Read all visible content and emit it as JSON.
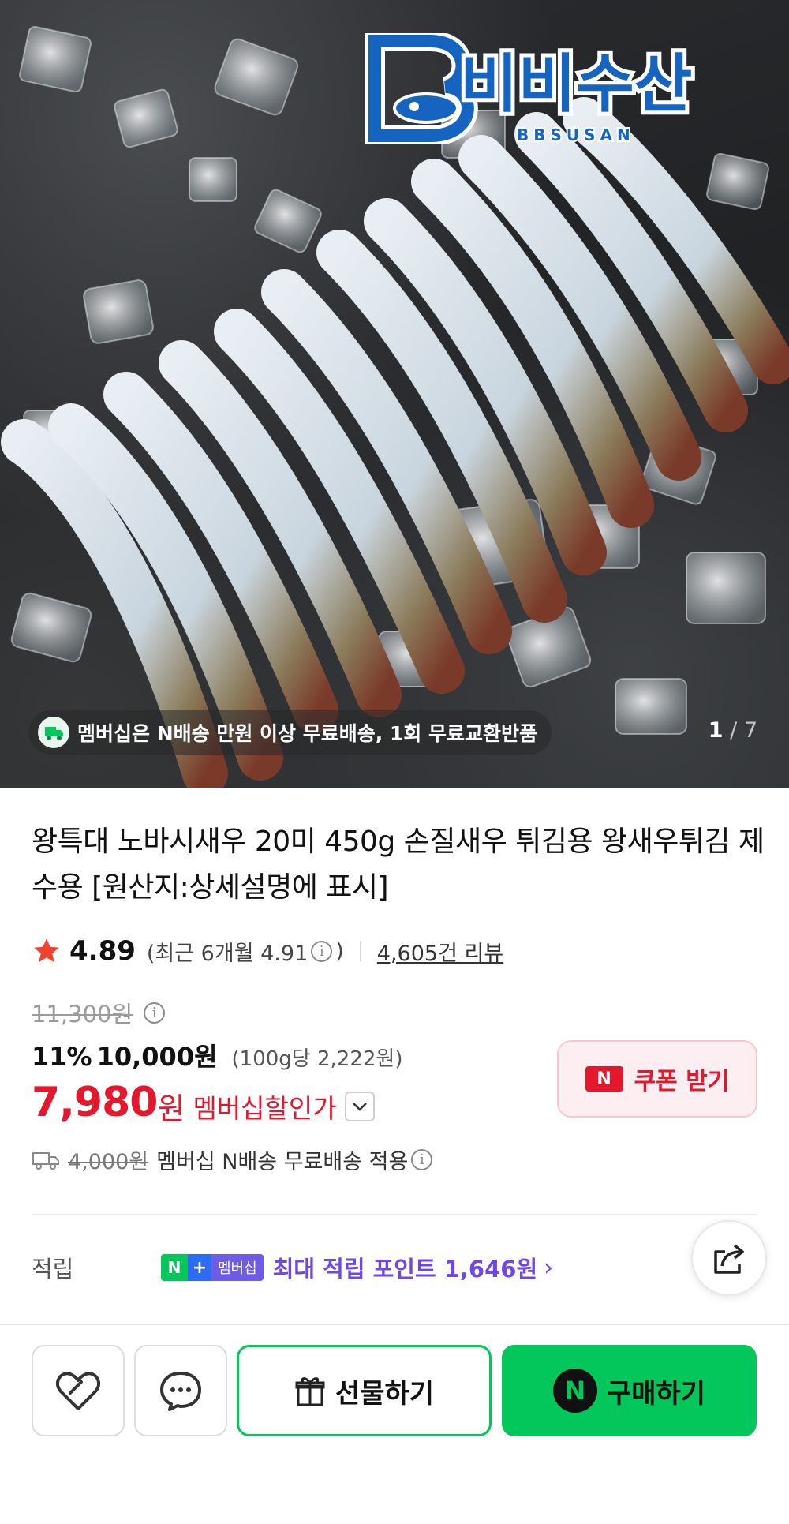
{
  "hero": {
    "brand_name": "비비수산",
    "brand_sub": "BBSUSAN",
    "notice": "멤버십은 N배송 만원 이상 무료배송, 1회 무료교환반품",
    "page_current": "1",
    "page_separator": "/",
    "page_total": "7"
  },
  "product": {
    "title": "왕특대 노바시새우 20미 450g 손질새우 튀김용 왕새우튀김 제수용 [원산지:상세설명에 표시]",
    "rating": "4.89",
    "recent_rating_text": "(최근 6개월 4.91",
    "recent_rating_close": ")",
    "review_count": "4,605건 리뷰",
    "original_price": "11,300원",
    "discount_percent": "11%",
    "sale_price": "10,000원",
    "unit_price": "(100g당 2,222원)",
    "member_price": "7,980",
    "member_price_unit": "원",
    "member_label": "멤버십할인가",
    "coupon_label": "쿠폰 받기",
    "coupon_badge": "N",
    "shipping_fee": "4,000원",
    "shipping_text": "멤버십 N배송 무료배송 적용"
  },
  "points": {
    "label": "적립",
    "badge_n": "N",
    "badge_plus": "+",
    "badge_member": "멤버십",
    "text": "최대 적립 포인트 1,646원",
    "arrow": "›"
  },
  "bottom_bar": {
    "gift_label": "선물하기",
    "buy_label": "구매하기",
    "buy_badge": "N"
  },
  "colors": {
    "naver_green": "#03c75a",
    "sale_red": "#e4182d",
    "points_purple": "#6f47e8",
    "brand_blue": "#1565c0"
  },
  "icons": [
    "star-icon",
    "info-icon",
    "truck-icon",
    "chevron-down-icon",
    "share-icon",
    "heart-icon",
    "talk-icon",
    "gift-icon"
  ]
}
